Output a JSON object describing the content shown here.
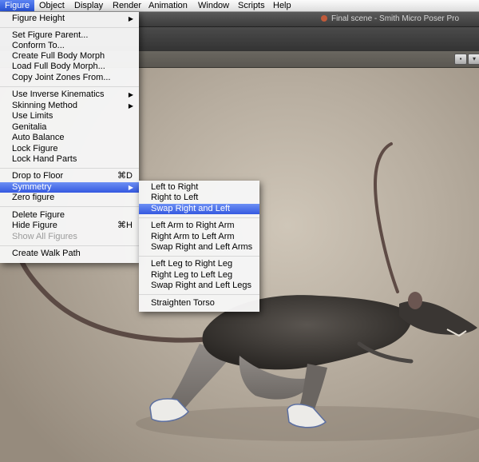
{
  "menubar": {
    "items": [
      {
        "label": "Figure"
      },
      {
        "label": "Object"
      },
      {
        "label": "Display"
      },
      {
        "label": "Render"
      },
      {
        "label": "Animation"
      },
      {
        "label": "Window"
      },
      {
        "label": "Scripts"
      },
      {
        "label": "Help"
      }
    ]
  },
  "window": {
    "title": "Final scene - Smith Micro Poser Pro"
  },
  "figure_menu": {
    "items": [
      {
        "label": "Figure Height",
        "submenu_arrow": "▶"
      },
      {
        "label": "Set Figure Parent..."
      },
      {
        "label": "Conform To..."
      },
      {
        "label": "Create Full Body Morph"
      },
      {
        "label": "Load Full Body Morph..."
      },
      {
        "label": "Copy Joint Zones From..."
      },
      {
        "label": "Use Inverse Kinematics",
        "submenu_arrow": "▶"
      },
      {
        "label": "Skinning Method",
        "submenu_arrow": "▶"
      },
      {
        "label": "Use Limits"
      },
      {
        "label": "Genitalia"
      },
      {
        "label": "Auto Balance"
      },
      {
        "label": "Lock Figure"
      },
      {
        "label": "Lock Hand Parts"
      },
      {
        "label": "Drop to Floor",
        "shortcut": "⌘D"
      },
      {
        "label": "Symmetry",
        "submenu_arrow": "▶"
      },
      {
        "label": "Zero figure"
      },
      {
        "label": "Delete Figure"
      },
      {
        "label": "Hide Figure",
        "shortcut": "⌘H"
      },
      {
        "label": "Show All Figures"
      },
      {
        "label": "Create Walk Path"
      }
    ]
  },
  "symmetry_submenu": {
    "items": [
      {
        "label": "Left to Right"
      },
      {
        "label": "Right to Left"
      },
      {
        "label": "Swap Right and Left"
      },
      {
        "label": "Left Arm to Right Arm"
      },
      {
        "label": "Right Arm to Left Arm"
      },
      {
        "label": "Swap Right and Left Arms"
      },
      {
        "label": "Left Leg to Right Leg"
      },
      {
        "label": "Right Leg to Left Leg"
      },
      {
        "label": "Swap Right and Left Legs"
      },
      {
        "label": "Straighten Torso"
      }
    ]
  },
  "colors": {
    "highlight": "#3559e0",
    "viewport_bg": "#b7ad9f"
  }
}
